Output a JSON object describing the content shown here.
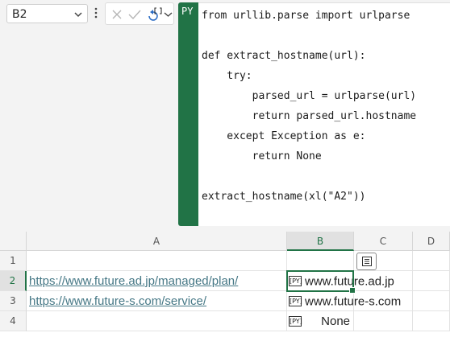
{
  "name_box": {
    "value": "B2",
    "icon": "chevron-down-icon"
  },
  "formula_bar": {
    "menu_icon": "more-vertical-icon",
    "cancel_icon": "cancel-x-icon",
    "enter_icon": "check-icon",
    "python_icon": "python-insert-icon",
    "expand_icon": "chevron-down-icon",
    "mode_label": "PY",
    "code_lines": [
      "from urllib.parse import urlparse",
      "",
      "def extract_hostname(url):",
      "    try:",
      "        parsed_url = urlparse(url)",
      "        return parsed_url.hostname",
      "    except Exception as e:",
      "        return None",
      "",
      "extract_hostname(xl(\"A2\"))"
    ]
  },
  "grid": {
    "columns": [
      "A",
      "B",
      "C",
      "D"
    ],
    "active_column": "B",
    "active_row": "2",
    "rows": [
      {
        "num": "1",
        "a": "",
        "b": ""
      },
      {
        "num": "2",
        "a": "https://www.future.ad.jp/managed/plan/",
        "b": "www.future.ad.jp"
      },
      {
        "num": "3",
        "a": "https://www.future-s.com/service/",
        "b": "www.future-s.com"
      },
      {
        "num": "4",
        "a": "",
        "b": "None"
      }
    ],
    "py_badge": "[PY]",
    "card_icon": "card-view-icon"
  },
  "colors": {
    "accent": "#217346",
    "link": "#467886"
  }
}
